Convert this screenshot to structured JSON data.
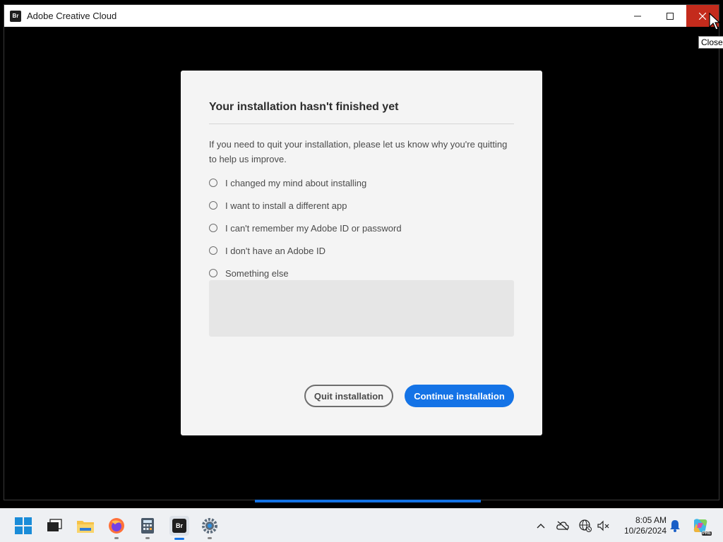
{
  "window": {
    "title": "Adobe Creative Cloud",
    "app_icon_text": "Br",
    "tooltip": "Close"
  },
  "dialog": {
    "title": "Your installation hasn't finished yet",
    "description": "If you need to quit your installation, please let us know why you're quitting to help us improve.",
    "options": [
      {
        "label": "I changed my mind about installing",
        "selected": false
      },
      {
        "label": "I want to install a different app",
        "selected": false
      },
      {
        "label": "I can't remember my Adobe ID or password",
        "selected": false
      },
      {
        "label": "I don't have an Adobe ID",
        "selected": false
      },
      {
        "label": "Something else",
        "selected": false
      }
    ],
    "feedback_value": "",
    "quit_label": "Quit installation",
    "continue_label": "Continue installation"
  },
  "taskbar": {
    "apps": [
      "start",
      "task-view",
      "file-explorer",
      "firefox",
      "calculator",
      "adobe-bridge",
      "settings"
    ],
    "bridge_label": "Br",
    "time": "8:05 AM",
    "date": "10/26/2024",
    "copilot_badge": "PRE"
  },
  "colors": {
    "accent": "#1473e6",
    "close_red": "#c42b1c",
    "dialog_bg": "#f4f4f4"
  }
}
